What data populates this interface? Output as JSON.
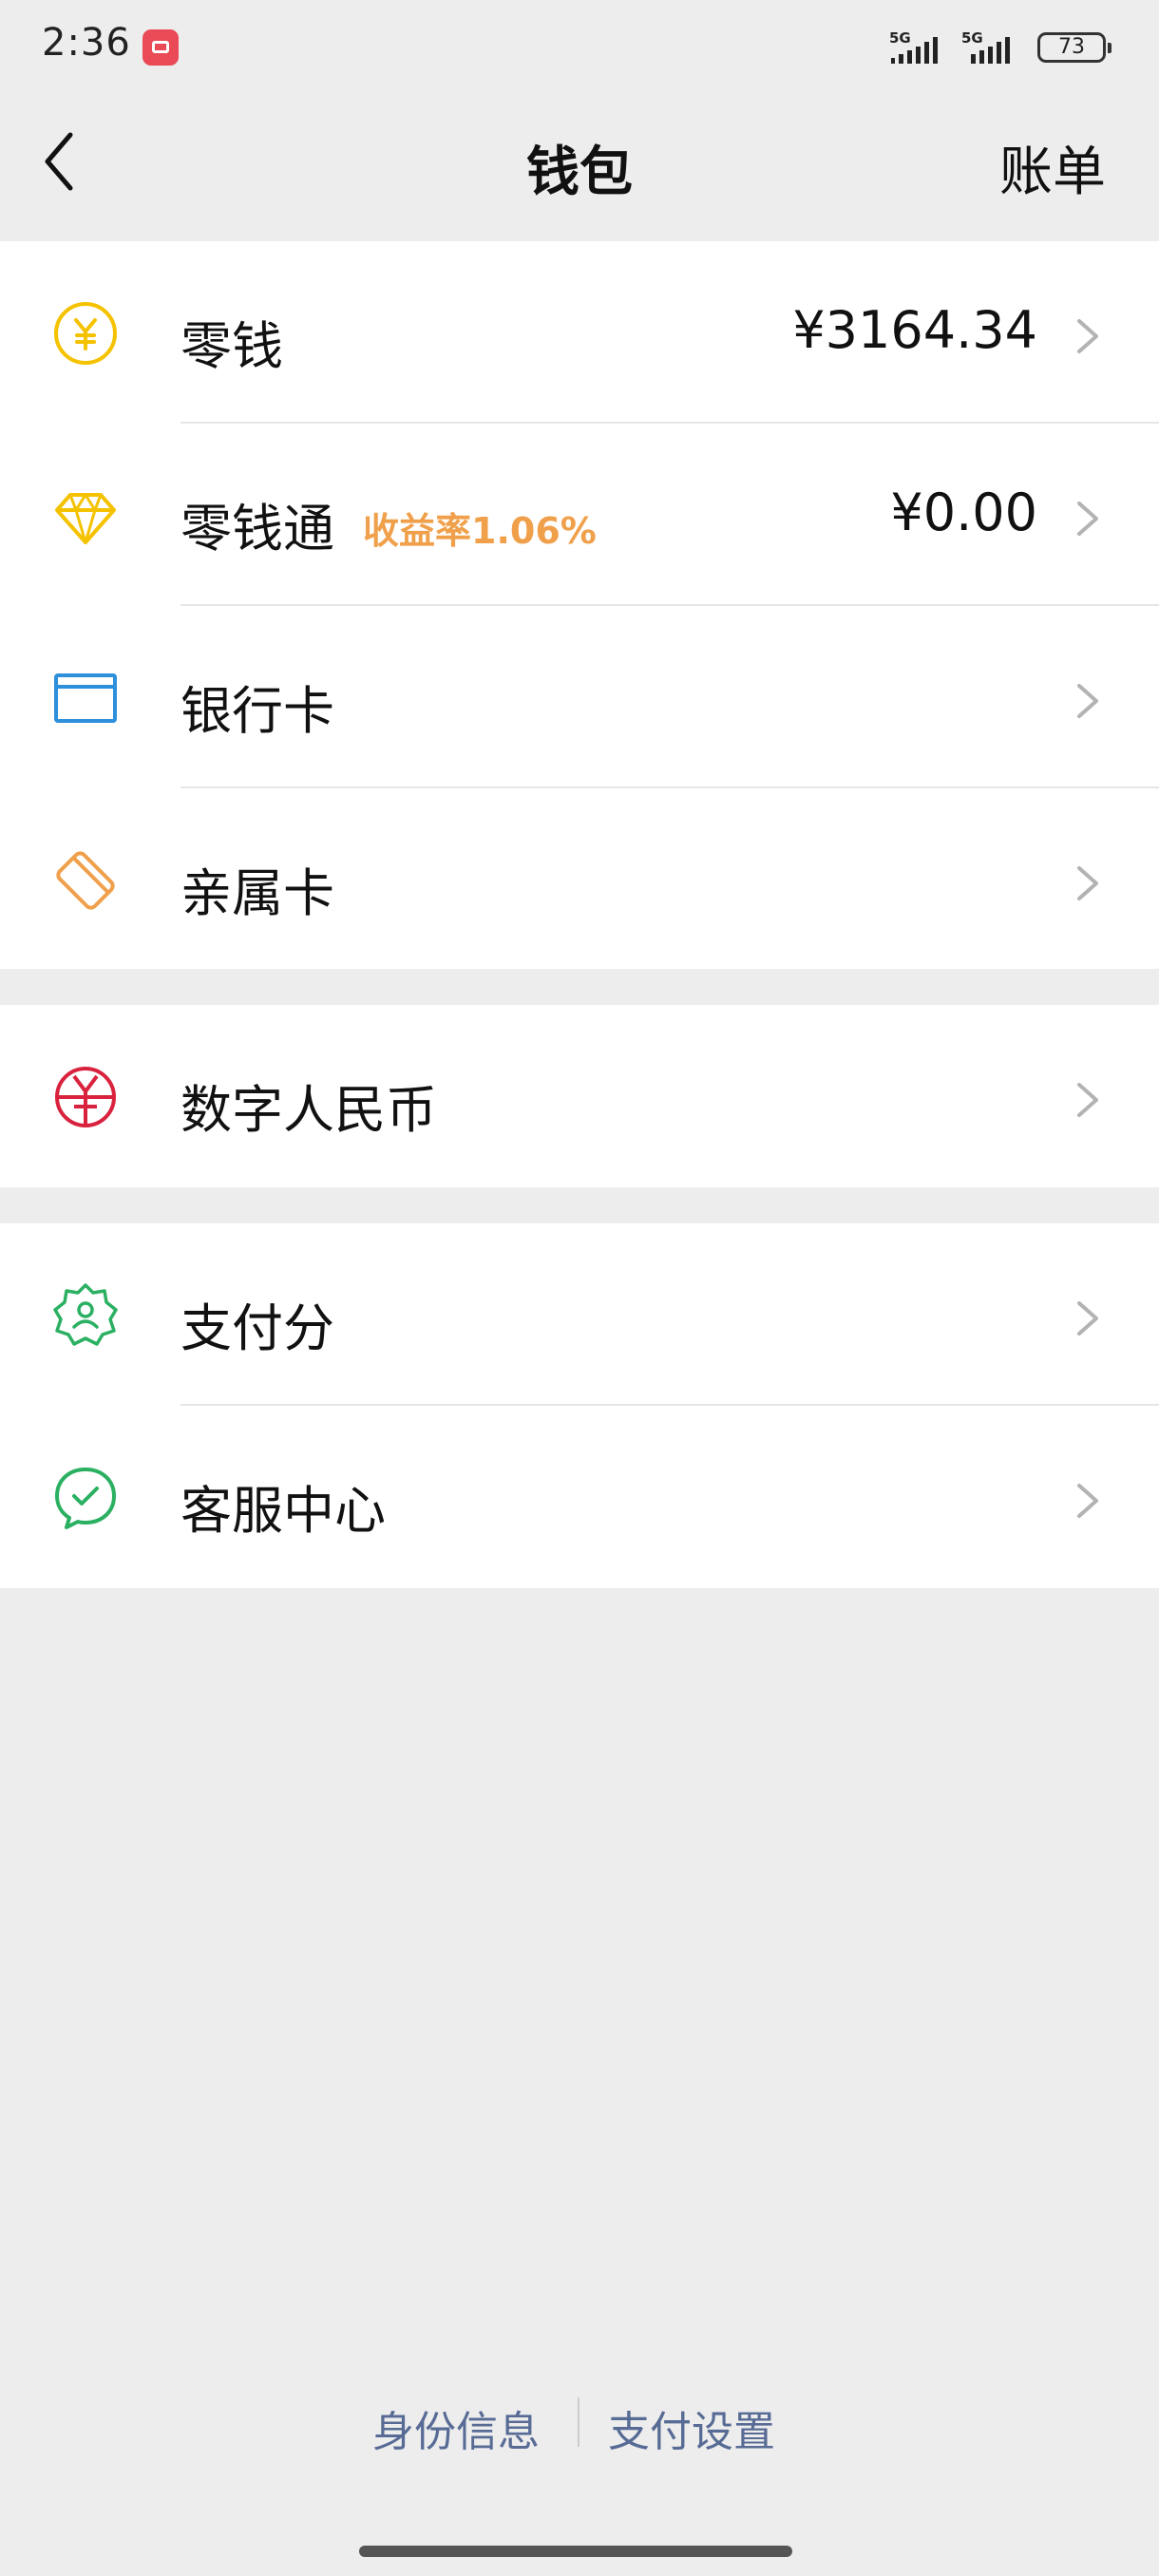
{
  "status_bar": {
    "time": "2:36",
    "network_1": "5G",
    "network_2": "5G",
    "battery": "73"
  },
  "nav": {
    "title": "钱包",
    "right_action": "账单"
  },
  "groups": [
    {
      "items": [
        {
          "label": "零钱",
          "value": "¥3164.34",
          "icon": "yen-coin-icon"
        },
        {
          "label": "零钱通",
          "badge": "收益率1.06%",
          "value": "¥0.00",
          "icon": "diamond-icon"
        },
        {
          "label": "银行卡",
          "icon": "bank-card-icon"
        },
        {
          "label": "亲属卡",
          "icon": "family-card-icon"
        }
      ]
    },
    {
      "items": [
        {
          "label": "数字人民币",
          "icon": "digital-rmb-icon"
        }
      ]
    },
    {
      "items": [
        {
          "label": "支付分",
          "icon": "pay-score-icon"
        },
        {
          "label": "客服中心",
          "icon": "customer-service-icon"
        }
      ]
    }
  ],
  "footer": {
    "link_1": "身份信息",
    "link_2": "支付设置"
  },
  "colors": {
    "background": "#EDEDED",
    "link": "#576B95",
    "rate": "#F0A04B",
    "yellow_icon": "#F5C200",
    "blue_icon": "#2E8FDB",
    "orange_icon": "#F0A04B",
    "red_icon": "#D9233E",
    "green_icon": "#2BB062"
  }
}
